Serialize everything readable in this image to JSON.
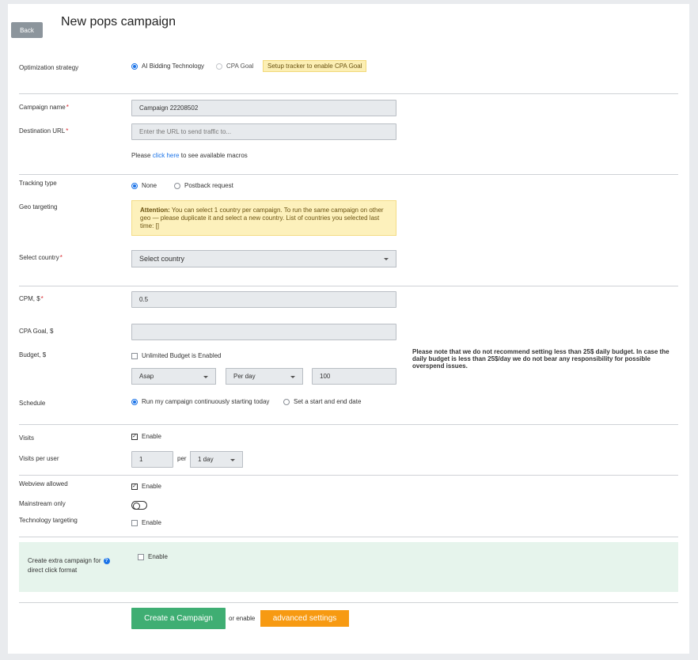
{
  "header": {
    "back_label": "Back",
    "title": "New pops campaign"
  },
  "optimization": {
    "label": "Optimization strategy",
    "options": [
      "AI Bidding Technology",
      "CPA Goal"
    ],
    "selected": "AI Bidding Technology",
    "badge": "Setup tracker to enable CPA Goal"
  },
  "campaign_name": {
    "label": "Campaign name",
    "value": "Campaign 22208502"
  },
  "destination_url": {
    "label": "Destination URL",
    "placeholder": "Enter the URL to send traffic to..."
  },
  "macros": {
    "prefix": "Please",
    "link": "click here",
    "suffix": "to see available macros"
  },
  "tracking": {
    "label": "Tracking type",
    "options": [
      "None",
      "Postback request"
    ],
    "selected": "None"
  },
  "geo": {
    "label": "Geo targeting",
    "attention_bold": "Attention:",
    "attention_text": "You can select 1 country per campaign. To run the same campaign on other geo — please duplicate it and select a new country. List of countries you selected last time: []"
  },
  "country": {
    "label": "Select country",
    "value": "Select country"
  },
  "cpm": {
    "label": "CPM, $",
    "value": "0.5"
  },
  "cpa_goal": {
    "label": "CPA Goal, $",
    "value": ""
  },
  "budget": {
    "label": "Budget, $",
    "unlimited_label": "Unlimited Budget is Enabled",
    "pacing": "Asap",
    "period": "Per day",
    "amount": "100",
    "note": "Please note that we do not recommend setting less than 25$ daily budget. In case the daily budget is less than 25$/day we do not bear any responsibility for possible overspend issues."
  },
  "schedule": {
    "label": "Schedule",
    "options": [
      "Run my campaign continuously starting today",
      "Set a start and end date"
    ],
    "selected": "Run my campaign continuously starting today"
  },
  "visits": {
    "label": "Visits",
    "enable_label": "Enable",
    "checked": true
  },
  "visits_per_user": {
    "label": "Visits per user",
    "value": "1",
    "per_label": "per",
    "period": "1 day"
  },
  "webview": {
    "label": "Webview allowed",
    "enable_label": "Enable",
    "checked": true
  },
  "mainstream": {
    "label": "Mainstream only",
    "on": false
  },
  "technology": {
    "label": "Technology targeting",
    "enable_label": "Enable",
    "checked": false
  },
  "extra_campaign": {
    "label_line1": "Create extra campaign for",
    "label_line2": "direct click format",
    "enable_label": "Enable"
  },
  "footer": {
    "create_label": "Create a Campaign",
    "or_label": "or enable",
    "advanced_label": "advanced settings"
  },
  "colors": {
    "primary": "#3fae73",
    "accent": "#f79a12",
    "link": "#1a73e8",
    "required": "#d9282f"
  }
}
